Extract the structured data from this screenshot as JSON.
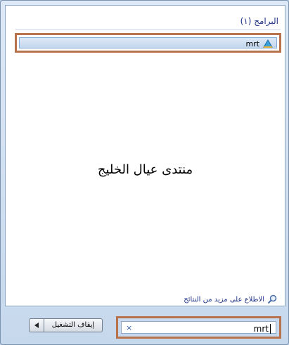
{
  "results": {
    "group_header": "البرامج (١)",
    "programs": [
      {
        "label": "mrt",
        "icon": "mrt-program-icon"
      }
    ]
  },
  "overlay_text": "منتدى عيال الخليج",
  "see_more": {
    "label": "الاطلاع على مزيد من النتائج",
    "icon": "magnifier-icon"
  },
  "search": {
    "value": "mrt",
    "clear_glyph": "×"
  },
  "shutdown": {
    "label": "إيقاف التشغيل",
    "options_icon": "triangle-left-icon"
  },
  "colors": {
    "highlight": "#b8734d",
    "link": "#1e3287"
  }
}
